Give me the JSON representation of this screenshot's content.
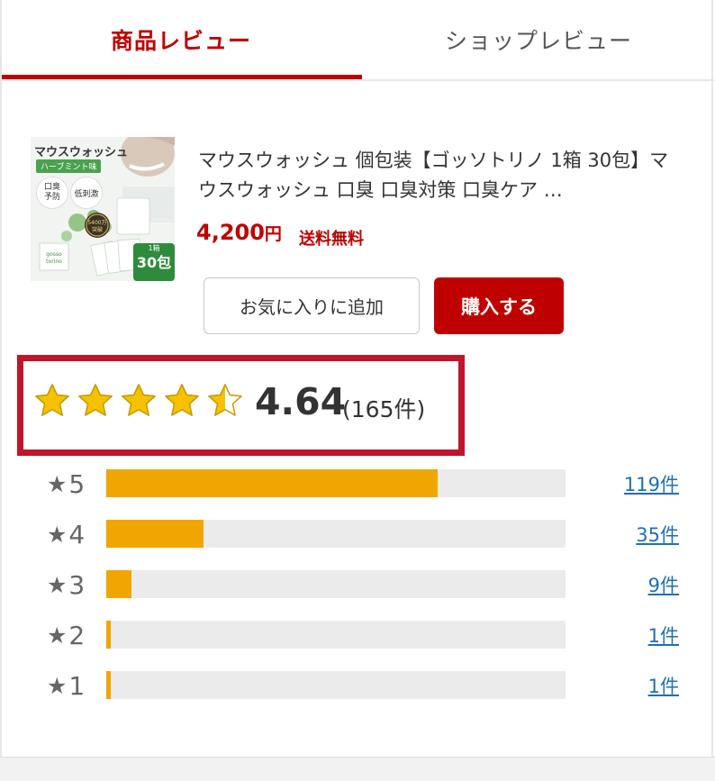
{
  "tabs": {
    "active": "商品レビュー",
    "inactive": "ショップレビュー"
  },
  "product": {
    "title": "マウスウォッシュ 個包装【ゴッソトリノ 1箱 30包】マウスウォッシュ 口臭 口臭対策 口臭ケア …",
    "price_number": "4,200",
    "price_unit": "円",
    "shipping": "送料無料",
    "thumb": {
      "brand": "マウスウォッシュ",
      "flavor": "ハーブミント味",
      "badge1": "口臭\n予防",
      "badge2": "低刺激",
      "sales": "5400万\n突破",
      "box_small": "1箱",
      "box_big": "30包"
    }
  },
  "buttons": {
    "favorite": "お気に入りに追加",
    "buy": "購入する"
  },
  "rating": {
    "average": "4.64",
    "count_text": "(165件)",
    "stars_value": 4.64,
    "star_color": "#f6c200"
  },
  "distribution": [
    {
      "star": "5",
      "count": 119,
      "label": "119件"
    },
    {
      "star": "4",
      "count": 35,
      "label": "35件"
    },
    {
      "star": "3",
      "count": 9,
      "label": "9件"
    },
    {
      "star": "2",
      "count": 1,
      "label": "1件"
    },
    {
      "star": "1",
      "count": 1,
      "label": "1件"
    }
  ],
  "colors": {
    "accent": "#bf0000",
    "bar": "#f0a500",
    "link": "#1f6fb5"
  }
}
